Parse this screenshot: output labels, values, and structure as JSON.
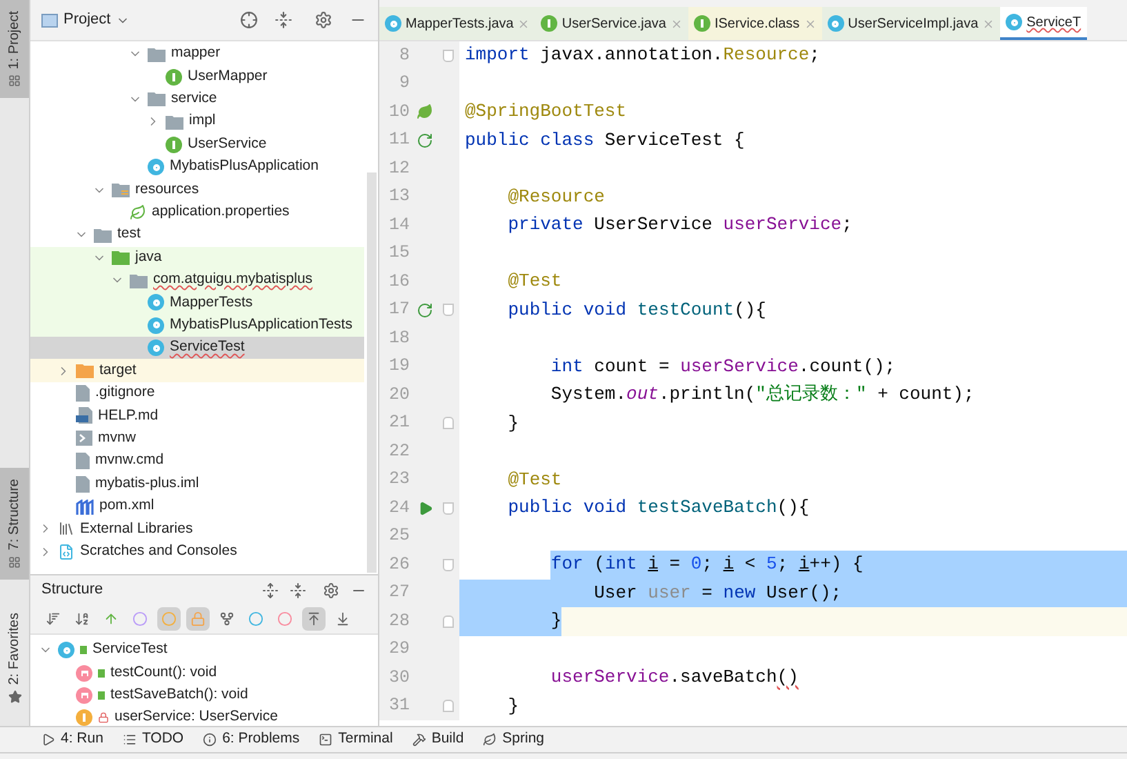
{
  "tool_stripe": {
    "top": [
      {
        "label": "1: Project",
        "selected": true
      }
    ],
    "bottom": [
      {
        "label": "7: Structure",
        "selected": true
      },
      {
        "label": "2: Favorites",
        "selected": false
      }
    ]
  },
  "project_panel": {
    "title": "Project",
    "tree": [
      {
        "children": [
          {
            "children": [
              {
                "children": [
                  {
                    "children": [
                      {
                        "children": [
                          {
                            "label": "mapper",
                            "kind": "package",
                            "expanded": true,
                            "children": [
                              {
                                "label": "UserMapper",
                                "kind": "interface"
                              }
                            ]
                          },
                          {
                            "label": "service",
                            "kind": "package",
                            "expanded": true,
                            "children": [
                              {
                                "label": "impl",
                                "kind": "package",
                                "expanded": false
                              },
                              {
                                "label": "UserService",
                                "kind": "interface"
                              }
                            ]
                          },
                          {
                            "label": "MybatisPlusApplication",
                            "kind": "spring_class"
                          }
                        ]
                      }
                    ]
                  },
                  {
                    "label": "resources",
                    "kind": "resources_folder",
                    "expanded": true,
                    "children": [
                      {
                        "label": "application.properties",
                        "kind": "properties"
                      }
                    ]
                  }
                ]
              },
              {
                "label": "test",
                "kind": "folder",
                "expanded": true,
                "children": [
                  {
                    "label": "java",
                    "kind": "test_folder",
                    "test_source": true,
                    "expanded": true,
                    "children": [
                      {
                        "label": "com.atguigu.mybatisplus",
                        "kind": "package",
                        "test_source": true,
                        "misspelled": true,
                        "expanded": true,
                        "children": [
                          {
                            "label": "MapperTests",
                            "kind": "test_class",
                            "test_source": true
                          },
                          {
                            "label": "MybatisPlusApplicationTests",
                            "kind": "test_class",
                            "test_source": true
                          },
                          {
                            "label": "ServiceTest",
                            "kind": "test_class",
                            "selected": true,
                            "misspelled": true
                          }
                        ]
                      }
                    ]
                  }
                ]
              }
            ]
          },
          {
            "label": "target",
            "kind": "excluded_folder",
            "excluded": true,
            "expanded": false
          },
          {
            "label": ".gitignore",
            "kind": "file"
          },
          {
            "label": "HELP.md",
            "kind": "markdown"
          },
          {
            "label": "mvnw",
            "kind": "script"
          },
          {
            "label": "mvnw.cmd",
            "kind": "file"
          },
          {
            "label": "mybatis-plus.iml",
            "kind": "file"
          },
          {
            "label": "pom.xml",
            "kind": "maven"
          }
        ]
      },
      {
        "label": "External Libraries",
        "kind": "libraries",
        "expanded": false
      },
      {
        "label": "Scratches and Consoles",
        "kind": "scratches",
        "expanded": false
      }
    ]
  },
  "structure_panel": {
    "title": "Structure",
    "toolbar": [
      {
        "kind": "sort_visibility",
        "on": false
      },
      {
        "kind": "sort_alpha",
        "on": false
      },
      {
        "kind": "inherited",
        "on": false
      },
      {
        "kind": "properties",
        "on": false
      },
      {
        "kind": "fields",
        "on": true
      },
      {
        "kind": "non_public",
        "on": true
      },
      {
        "kind": "anonymous",
        "on": false
      },
      {
        "kind": "lambdas_circle",
        "on": false
      },
      {
        "kind": "lambdas",
        "on": false
      },
      {
        "kind": "autoscroll_to",
        "on": true
      },
      {
        "kind": "autoscroll_from",
        "on": false
      }
    ],
    "tree": [
      {
        "label": "ServiceTest",
        "kind": "test_class",
        "locked": false,
        "expanded": true,
        "children": [
          {
            "label": "testCount(): void",
            "kind": "method",
            "locked": false
          },
          {
            "label": "testSaveBatch(): void",
            "kind": "method",
            "locked": false
          },
          {
            "label": "userService: UserService",
            "kind": "field",
            "locked": true
          }
        ]
      }
    ]
  },
  "editor_tabs": [
    {
      "label": "MapperTests.java",
      "kind": "test_class",
      "selected": false,
      "library": false
    },
    {
      "label": "UserService.java",
      "kind": "interface",
      "selected": false,
      "library": false
    },
    {
      "label": "IService.class",
      "kind": "interface",
      "selected": false,
      "library": true
    },
    {
      "label": "UserServiceImpl.java",
      "kind": "class",
      "selected": false,
      "library": false
    },
    {
      "label": "ServiceT",
      "kind": "test_class",
      "selected": true,
      "library": false
    }
  ],
  "code": [
    {
      "number": "8",
      "fold": {
        "kind": "start"
      },
      "tokens": [
        {
          "text": "import ",
          "kind": "keyword"
        },
        {
          "text": "javax.annotation.",
          "kind": "plain"
        },
        {
          "text": "Resource",
          "kind": "annotation"
        },
        {
          "text": ";",
          "kind": "plain"
        }
      ]
    },
    {
      "number": "9"
    },
    {
      "number": "10",
      "gutter": {
        "kind": "spring"
      },
      "tokens": [
        {
          "text": "@SpringBootTest",
          "kind": "annotation"
        }
      ]
    },
    {
      "number": "11",
      "gutter": {
        "kind": "rerun"
      },
      "tokens": [
        {
          "text": "public class ",
          "kind": "keyword"
        },
        {
          "text": "ServiceTest {",
          "kind": "plain"
        }
      ]
    },
    {
      "number": "12"
    },
    {
      "number": "13",
      "tokens": [
        {
          "text": "    @Resource",
          "kind": "annotation"
        }
      ]
    },
    {
      "number": "14",
      "tokens": [
        {
          "text": "    private ",
          "kind": "keyword"
        },
        {
          "text": "UserService ",
          "kind": "plain"
        },
        {
          "text": "userService",
          "kind": "field"
        },
        {
          "text": ";",
          "kind": "plain"
        }
      ]
    },
    {
      "number": "15"
    },
    {
      "number": "16",
      "tokens": [
        {
          "text": "    @Test",
          "kind": "annotation"
        }
      ]
    },
    {
      "number": "17",
      "gutter": {
        "kind": "rerun"
      },
      "fold": {
        "kind": "start"
      },
      "tokens": [
        {
          "text": "    public void ",
          "kind": "keyword"
        },
        {
          "text": "testCount",
          "kind": "method"
        },
        {
          "text": "(){",
          "kind": "plain"
        }
      ]
    },
    {
      "number": "18"
    },
    {
      "number": "19",
      "tokens": [
        {
          "text": "        int ",
          "kind": "keyword"
        },
        {
          "text": "count = ",
          "kind": "plain"
        },
        {
          "text": "userService",
          "kind": "field"
        },
        {
          "text": ".count();",
          "kind": "plain"
        }
      ]
    },
    {
      "number": "20",
      "tokens": [
        {
          "text": "        System.",
          "kind": "plain"
        },
        {
          "text": "out",
          "kind": "static_field"
        },
        {
          "text": ".println(",
          "kind": "plain"
        },
        {
          "text": "\"总记录数：\"",
          "kind": "string"
        },
        {
          "text": " + count);",
          "kind": "plain"
        }
      ]
    },
    {
      "number": "21",
      "fold": {
        "kind": "end"
      },
      "tokens": [
        {
          "text": "    }",
          "kind": "plain"
        }
      ]
    },
    {
      "number": "22"
    },
    {
      "number": "23",
      "tokens": [
        {
          "text": "    @Test",
          "kind": "annotation"
        }
      ]
    },
    {
      "number": "24",
      "gutter": {
        "kind": "run"
      },
      "fold": {
        "kind": "start"
      },
      "tokens": [
        {
          "text": "    public void ",
          "kind": "keyword"
        },
        {
          "text": "testSaveBatch",
          "kind": "method"
        },
        {
          "text": "(){",
          "kind": "plain"
        }
      ]
    },
    {
      "number": "25"
    },
    {
      "number": "26",
      "fold": {
        "kind": "start"
      },
      "selection": {
        "kind": "from_text"
      },
      "tokens": [
        {
          "text": "        for ",
          "kind": "keyword"
        },
        {
          "text": "(",
          "kind": "plain"
        },
        {
          "text": "int ",
          "kind": "keyword"
        },
        {
          "text": "i",
          "kind": "underlined"
        },
        {
          "text": " = ",
          "kind": "plain"
        },
        {
          "text": "0",
          "kind": "number"
        },
        {
          "text": "; ",
          "kind": "plain"
        },
        {
          "text": "i",
          "kind": "underlined"
        },
        {
          "text": " < ",
          "kind": "plain"
        },
        {
          "text": "5",
          "kind": "number"
        },
        {
          "text": "; ",
          "kind": "plain"
        },
        {
          "text": "i",
          "kind": "underlined"
        },
        {
          "text": "++) {",
          "kind": "plain"
        }
      ]
    },
    {
      "number": "27",
      "selection": {
        "kind": "full"
      },
      "tokens": [
        {
          "text": "            User ",
          "kind": "plain"
        },
        {
          "text": "user",
          "kind": "unused"
        },
        {
          "text": " = ",
          "kind": "plain"
        },
        {
          "text": "new ",
          "kind": "keyword"
        },
        {
          "text": "User();",
          "kind": "plain"
        }
      ]
    },
    {
      "number": "28",
      "fold": {
        "kind": "end"
      },
      "current": true,
      "selection": {
        "kind": "to_text"
      },
      "tokens": [
        {
          "text": "        }",
          "kind": "plain"
        }
      ]
    },
    {
      "number": "29"
    },
    {
      "number": "30",
      "tokens": [
        {
          "text": "        userService",
          "kind": "field"
        },
        {
          "text": ".saveBatch",
          "kind": "plain"
        },
        {
          "text": "()",
          "kind": "error"
        }
      ]
    },
    {
      "number": "31",
      "fold": {
        "kind": "end"
      },
      "tokens": [
        {
          "text": "    }",
          "kind": "plain"
        }
      ]
    }
  ],
  "bottom_toolbar": [
    {
      "label": "4: Run",
      "kind": "run"
    },
    {
      "label": "TODO",
      "kind": "todo"
    },
    {
      "label": "6: Problems",
      "kind": "problems"
    },
    {
      "label": "Terminal",
      "kind": "terminal"
    },
    {
      "label": "Build",
      "kind": "build"
    },
    {
      "label": "Spring",
      "kind": "spring"
    }
  ]
}
